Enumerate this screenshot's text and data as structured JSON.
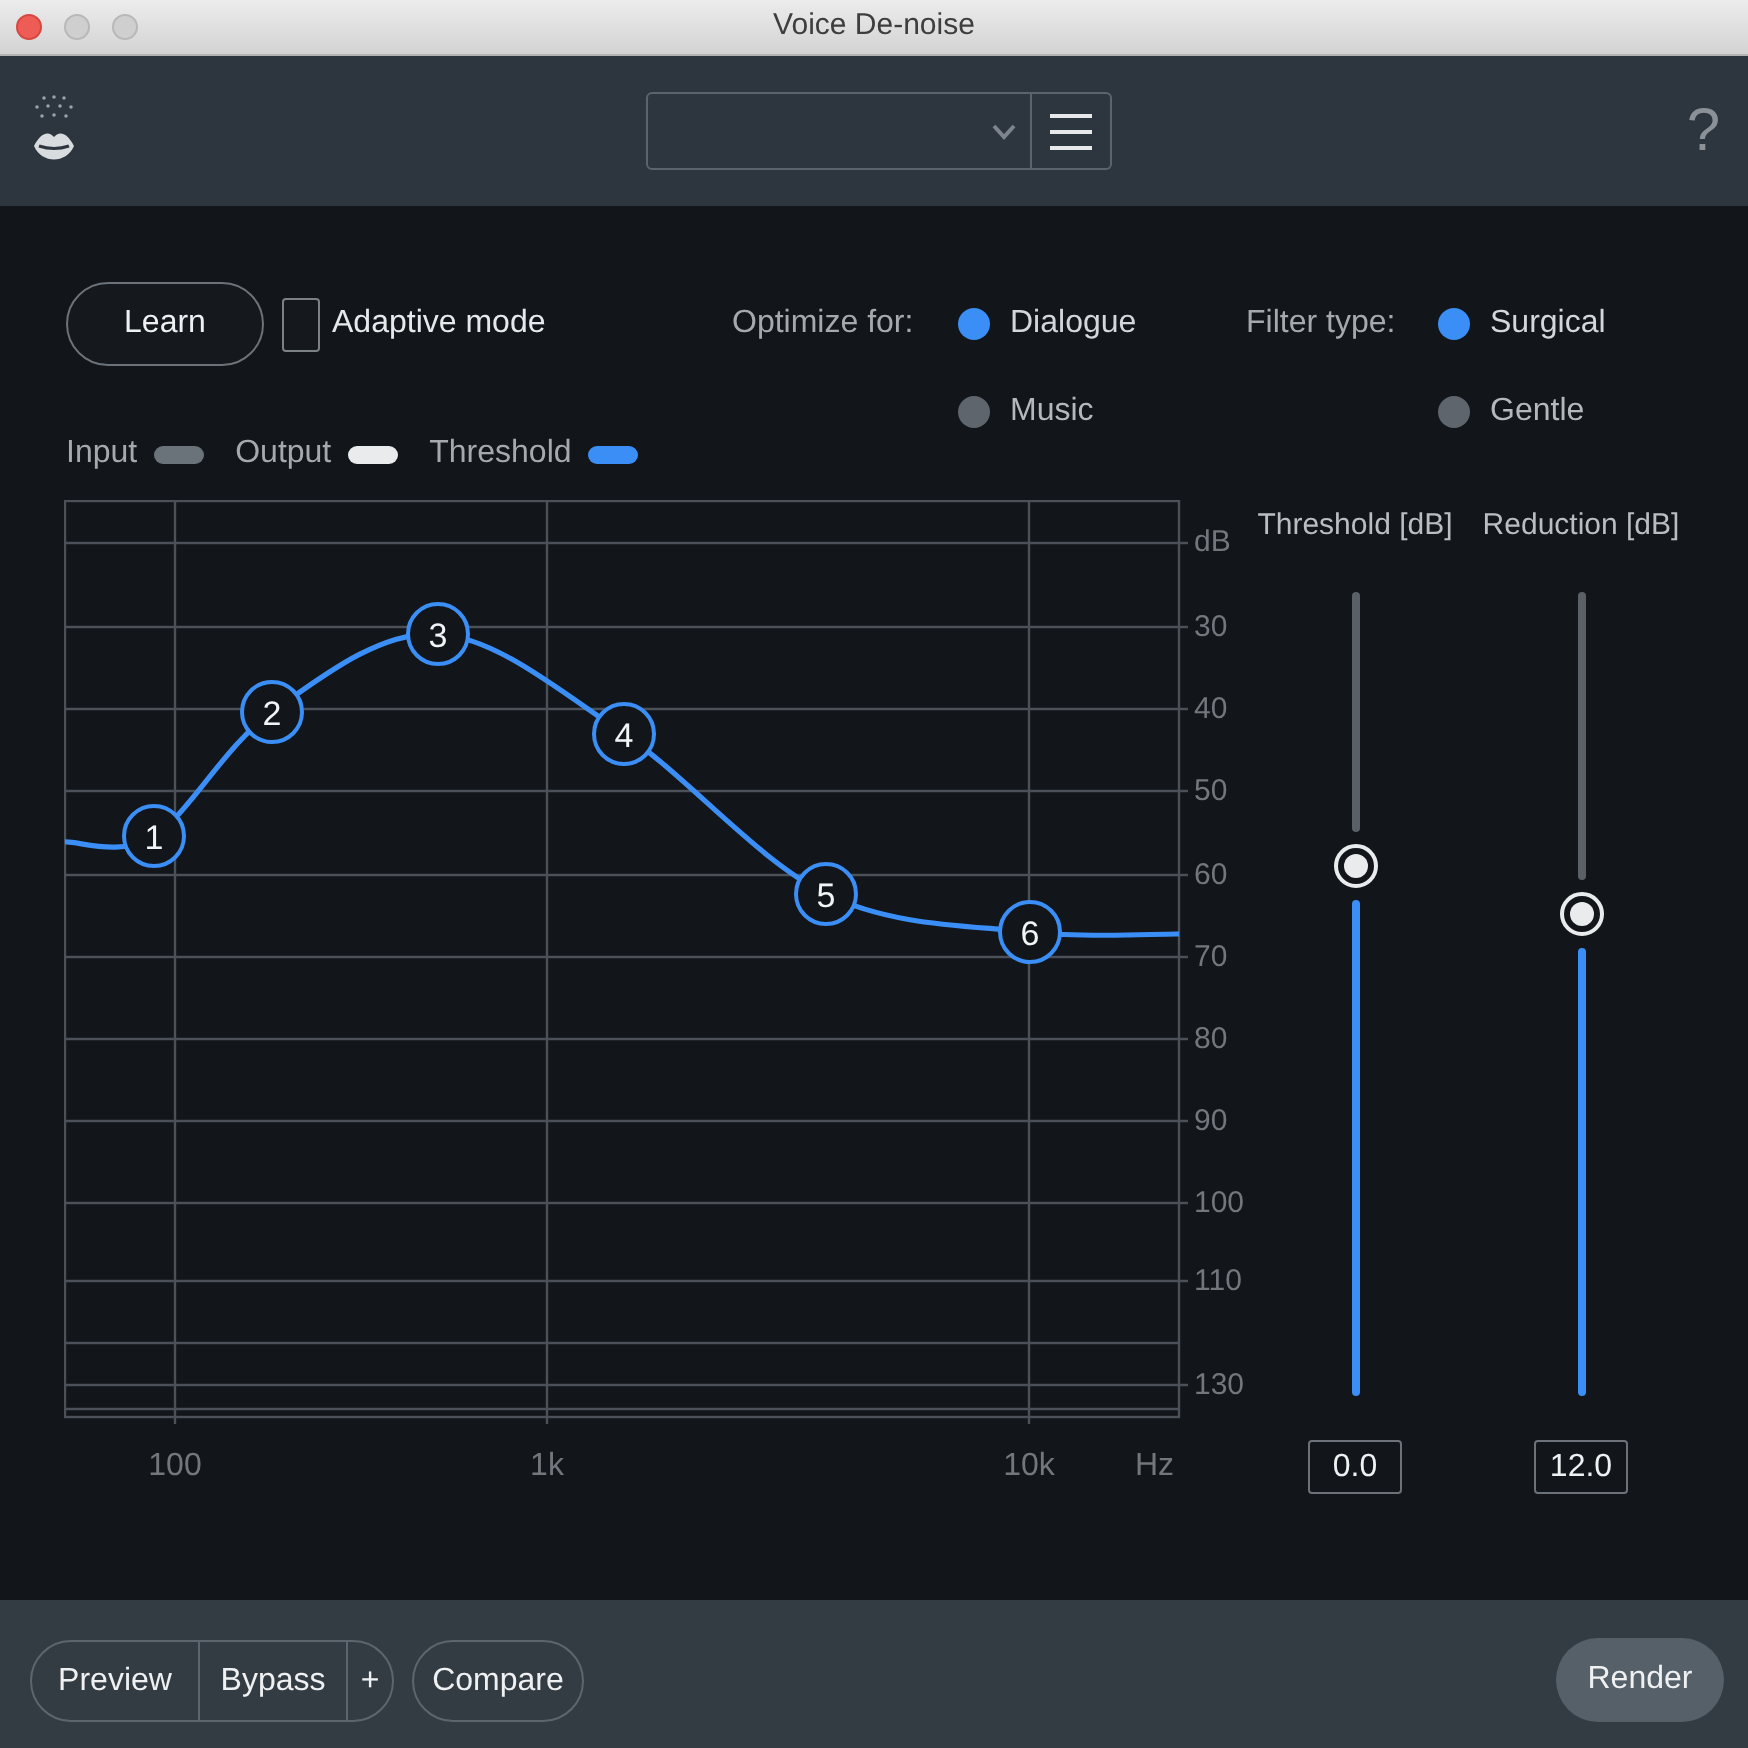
{
  "window": {
    "title": "Voice De-noise"
  },
  "toolbar": {
    "help": "?"
  },
  "controls": {
    "learn_button": "Learn",
    "adaptive_mode": {
      "label": "Adaptive mode",
      "checked": false
    },
    "optimize_for": {
      "label": "Optimize for:",
      "options": [
        {
          "label": "Dialogue",
          "selected": true
        },
        {
          "label": "Music",
          "selected": false
        }
      ]
    },
    "filter_type": {
      "label": "Filter type:",
      "options": [
        {
          "label": "Surgical",
          "selected": true
        },
        {
          "label": "Gentle",
          "selected": false
        }
      ]
    }
  },
  "legend": [
    {
      "label": "Input",
      "color": "#6b737a"
    },
    {
      "label": "Output",
      "color": "#e9ebed"
    },
    {
      "label": "Threshold",
      "color": "#3a8ef6"
    }
  ],
  "chart": {
    "y_axis": {
      "unit": "dB",
      "labels": [
        "30",
        "40",
        "50",
        "60",
        "70",
        "80",
        "90",
        "100",
        "110",
        "130"
      ]
    },
    "x_axis": {
      "labels": [
        "100",
        "1k",
        "10k"
      ],
      "unit": "Hz"
    },
    "nodes": [
      "1",
      "2",
      "3",
      "4",
      "5",
      "6"
    ]
  },
  "sliders": [
    {
      "label": "Threshold [dB]",
      "level": 0.66,
      "reading": "0.0"
    },
    {
      "label": "Reduction [dB]",
      "level": 0.6,
      "reading": "12.0"
    }
  ],
  "bottom_bar": {
    "transport": [
      "Preview",
      "Bypass",
      "+"
    ],
    "compare": "Compare",
    "render": "Render"
  }
}
